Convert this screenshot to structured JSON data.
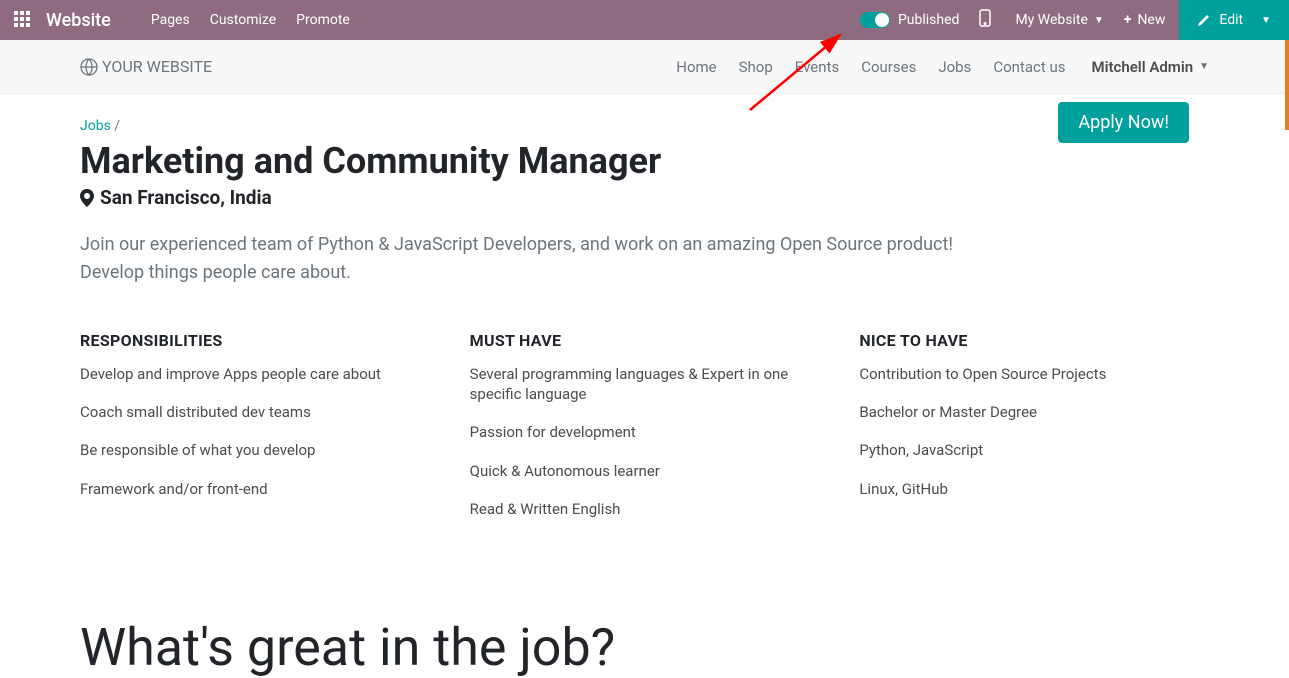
{
  "topbar": {
    "brand": "Website",
    "menu": [
      "Pages",
      "Customize",
      "Promote"
    ],
    "published_label": "Published",
    "my_website": "My Website",
    "new_label": "New",
    "edit_label": "Edit"
  },
  "sitenav": {
    "logo_text": "YOUR WEBSITE",
    "items": [
      "Home",
      "Shop",
      "Events",
      "Courses",
      "Jobs",
      "Contact us"
    ],
    "user": "Mitchell Admin"
  },
  "breadcrumb": {
    "parent": "Jobs",
    "sep": "/"
  },
  "job": {
    "title": "Marketing and Community Manager",
    "location": "San Francisco, India",
    "intro": "Join our experienced team of Python & JavaScript Developers, and work on an amazing Open Source product! Develop things people care about.",
    "apply_label": "Apply Now!"
  },
  "cols": {
    "responsibilities": {
      "heading": "RESPONSIBILITIES",
      "items": [
        "Develop and improve Apps people care about",
        "Coach small distributed dev teams",
        "Be responsible of what you develop",
        "Framework and/or front-end"
      ]
    },
    "must_have": {
      "heading": "MUST HAVE",
      "items": [
        "Several programming languages & Expert in one specific language",
        "Passion for development",
        "Quick & Autonomous learner",
        "Read & Written English"
      ]
    },
    "nice_to_have": {
      "heading": "NICE TO HAVE",
      "items": [
        "Contribution to Open Source Projects",
        "Bachelor or Master Degree",
        "Python, JavaScript",
        "Linux, GitHub"
      ]
    }
  },
  "big_question": "What's great in the job?"
}
